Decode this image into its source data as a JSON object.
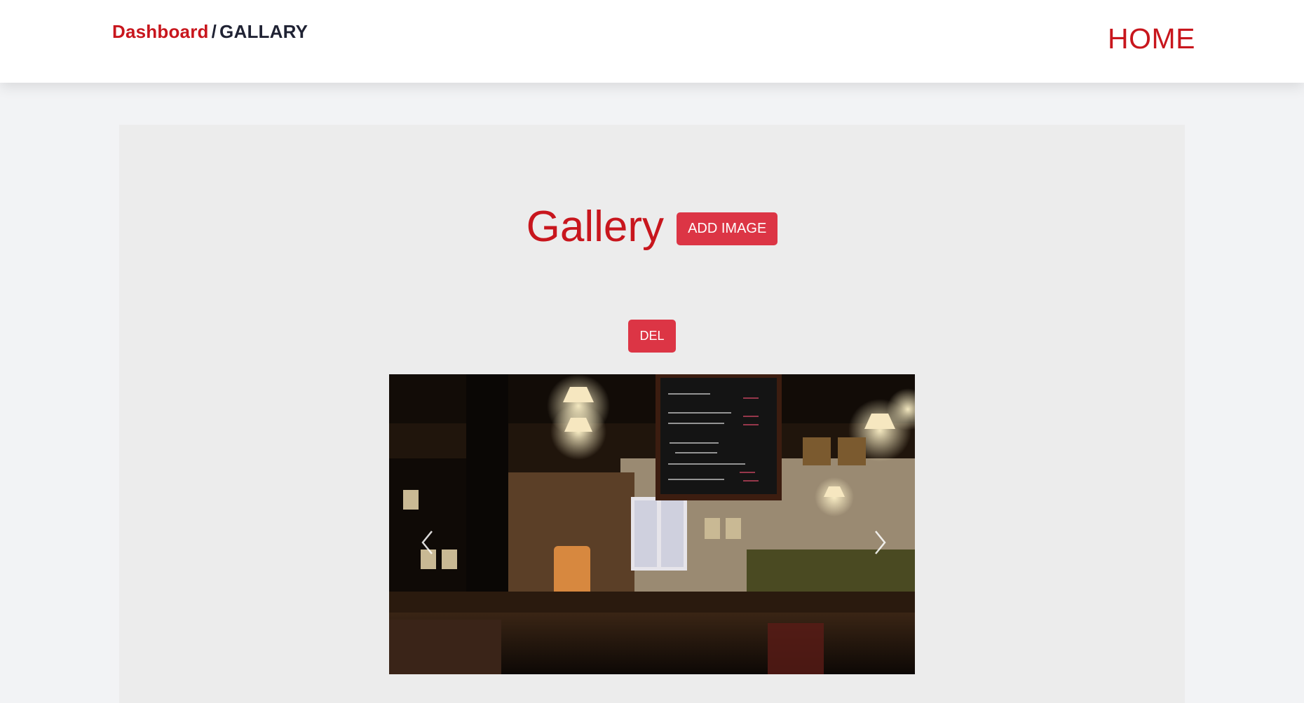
{
  "breadcrumb": {
    "parent": "Dashboard",
    "separator": "/",
    "current": "GALLARY"
  },
  "nav": {
    "home": "HOME"
  },
  "gallery": {
    "title": "Gallery",
    "add_label": "ADD IMAGE",
    "delete_label": "DEL"
  },
  "colors": {
    "accent": "#c8161d",
    "button": "#dc3545",
    "page_bg": "#f2f3f5",
    "panel_bg": "#ececec"
  },
  "icons": [
    "chevron-left-icon",
    "chevron-right-icon"
  ]
}
